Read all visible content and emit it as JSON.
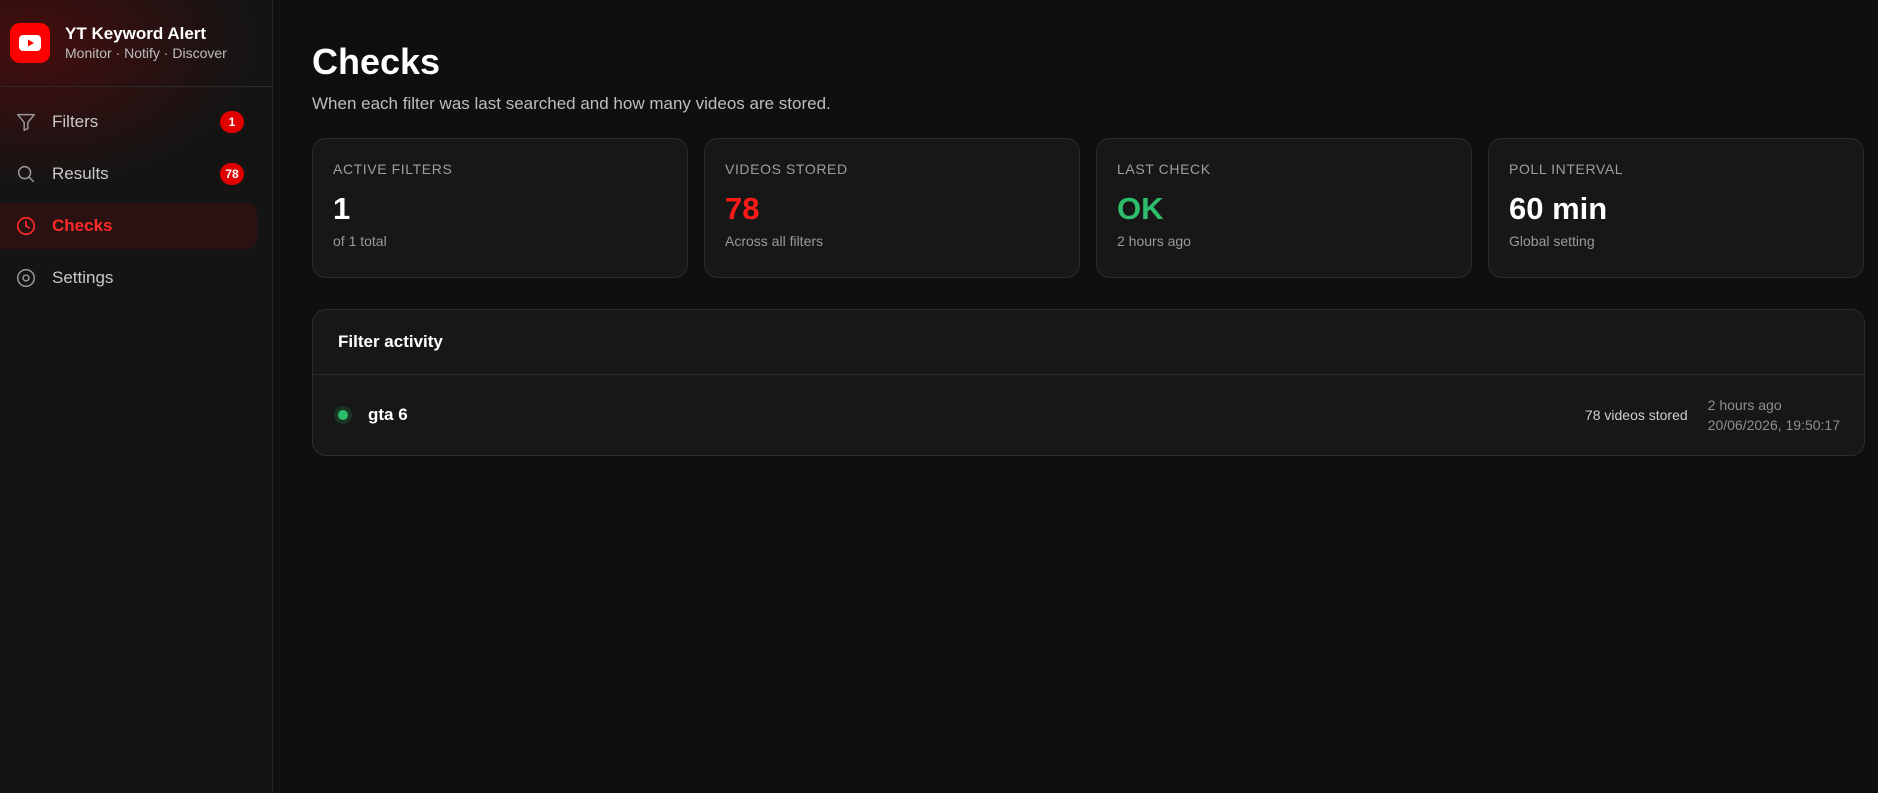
{
  "brand": {
    "title": "YT Keyword Alert",
    "subtitle": "Monitor · Notify · Discover",
    "accent": "#ff0000"
  },
  "sidebar": {
    "items": [
      {
        "label": "Filters",
        "icon": "filter-icon",
        "badge": "1",
        "active": false
      },
      {
        "label": "Results",
        "icon": "search-icon",
        "badge": "78",
        "active": false
      },
      {
        "label": "Checks",
        "icon": "clock-icon",
        "badge": "",
        "active": true
      },
      {
        "label": "Settings",
        "icon": "gear-icon",
        "badge": "",
        "active": false
      }
    ]
  },
  "page": {
    "title": "Checks",
    "subtitle": "When each filter was last searched and how many videos are stored."
  },
  "stats": [
    {
      "label": "Active filters",
      "value": "1",
      "note": "of 1 total",
      "color": "#ffffff"
    },
    {
      "label": "Videos stored",
      "value": "78",
      "note": "Across all filters",
      "color": "#ff1a1a"
    },
    {
      "label": "Last check",
      "value": "OK",
      "note": "2 hours ago",
      "color": "#2ebd6a"
    },
    {
      "label": "Poll interval",
      "value": "60 min",
      "note": "Global setting",
      "color": "#ffffff"
    }
  ],
  "activity": {
    "title": "Filter activity",
    "rows": [
      {
        "name": "gta 6",
        "status_color": "#2ebd6a",
        "count": "78 videos stored",
        "relative": "2 hours ago",
        "timestamp": "20/06/2026, 19:50:17"
      }
    ]
  }
}
